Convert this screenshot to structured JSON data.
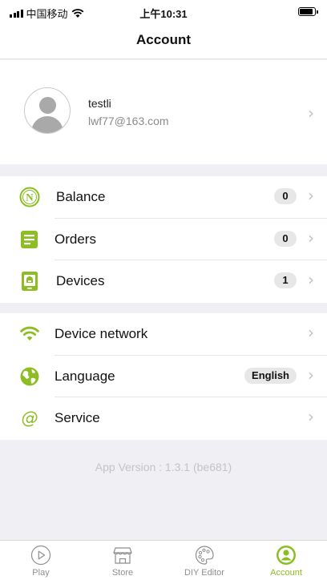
{
  "status_bar": {
    "carrier": "中国移动",
    "time": "上午10:31"
  },
  "header": {
    "title": "Account"
  },
  "profile": {
    "username": "testli",
    "email": "lwf77@163.com"
  },
  "menu_group_1": [
    {
      "label": "Balance",
      "badge": "0",
      "icon": "balance-n-icon"
    },
    {
      "label": "Orders",
      "badge": "0",
      "icon": "orders-icon"
    },
    {
      "label": "Devices",
      "badge": "1",
      "icon": "devices-icon"
    }
  ],
  "menu_group_2": [
    {
      "label": "Device network",
      "icon": "wifi-icon"
    },
    {
      "label": "Language",
      "badge": "English",
      "icon": "globe-icon"
    },
    {
      "label": "Service",
      "icon": "at-icon"
    }
  ],
  "app_version": "App Version : 1.3.1 (be681)",
  "tabs": [
    {
      "label": "Play",
      "icon": "play-icon"
    },
    {
      "label": "Store",
      "icon": "store-icon"
    },
    {
      "label": "DIY Editor",
      "icon": "palette-icon"
    },
    {
      "label": "Account",
      "icon": "account-icon",
      "active": true
    }
  ],
  "colors": {
    "accent": "#8cbd23",
    "background": "#efeff4"
  }
}
